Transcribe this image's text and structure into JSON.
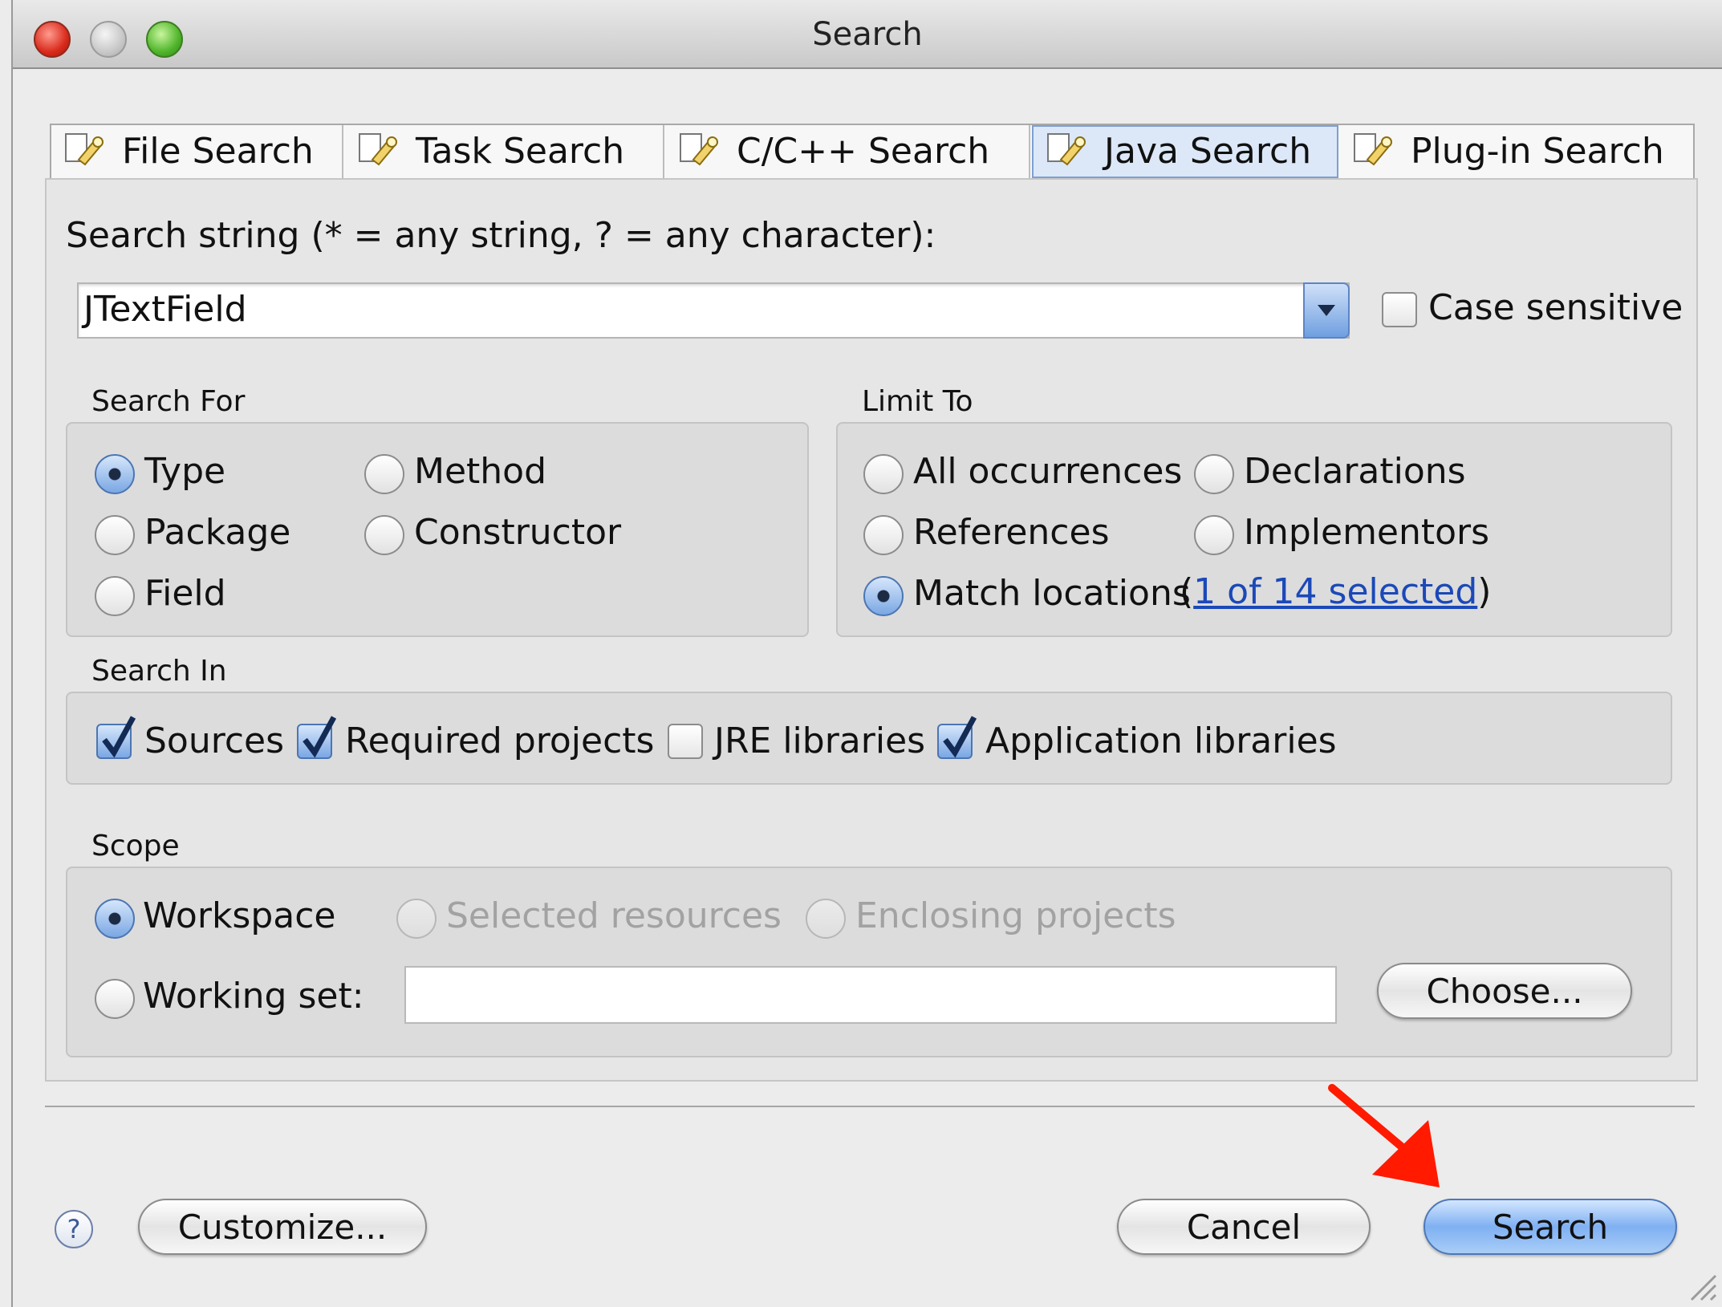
{
  "window": {
    "title": "Search"
  },
  "tabs": [
    {
      "label": "File Search",
      "active": false
    },
    {
      "label": "Task Search",
      "active": false
    },
    {
      "label": "C/C++ Search",
      "active": false
    },
    {
      "label": "Java Search",
      "active": true
    },
    {
      "label": "Plug-in Search",
      "active": false
    }
  ],
  "search_string": {
    "label": "Search string (* = any string, ? = any character):",
    "value": "JTextField",
    "case_sensitive_label": "Case sensitive",
    "case_sensitive": false
  },
  "search_for": {
    "title": "Search For",
    "options": [
      {
        "label": "Type",
        "selected": true
      },
      {
        "label": "Method",
        "selected": false
      },
      {
        "label": "Package",
        "selected": false
      },
      {
        "label": "Constructor",
        "selected": false
      },
      {
        "label": "Field",
        "selected": false
      }
    ]
  },
  "limit_to": {
    "title": "Limit To",
    "options": [
      {
        "label": "All occurrences",
        "selected": false
      },
      {
        "label": "Declarations",
        "selected": false
      },
      {
        "label": "References",
        "selected": false
      },
      {
        "label": "Implementors",
        "selected": false
      },
      {
        "label": "Match locations",
        "selected": true
      }
    ],
    "match_open": "(",
    "match_link": "1 of 14 selected",
    "match_close": ")"
  },
  "search_in": {
    "title": "Search In",
    "options": [
      {
        "label": "Sources",
        "checked": true
      },
      {
        "label": "Required projects",
        "checked": true
      },
      {
        "label": "JRE libraries",
        "checked": false
      },
      {
        "label": "Application libraries",
        "checked": true
      }
    ]
  },
  "scope": {
    "title": "Scope",
    "workspace": "Workspace",
    "selected_resources": "Selected resources",
    "enclosing_projects": "Enclosing projects",
    "working_set": "Working set:",
    "working_set_value": "",
    "choose_button": "Choose..."
  },
  "footer": {
    "help_icon": "?",
    "customize_button": "Customize...",
    "cancel_button": "Cancel",
    "search_button": "Search"
  },
  "colors": {
    "accent": "#7fb0f2",
    "annotation_arrow": "#ff1a00",
    "link": "#1b49b8"
  },
  "icons": {
    "tab_icon": "search-flashlight-icon",
    "dropdown": "chevron-down-icon",
    "help": "help-icon",
    "annotation": "red-arrow-annotation"
  }
}
